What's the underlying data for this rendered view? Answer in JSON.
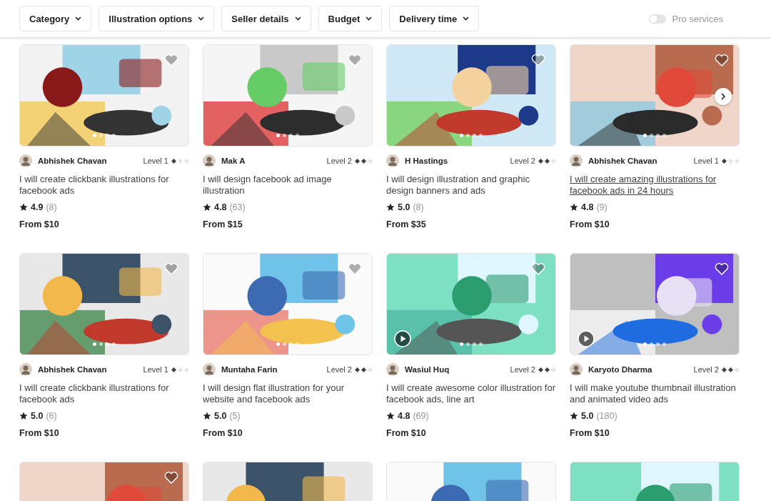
{
  "filters": [
    {
      "label": "Category"
    },
    {
      "label": "Illustration options"
    },
    {
      "label": "Seller details"
    },
    {
      "label": "Budget"
    },
    {
      "label": "Delivery time"
    }
  ],
  "pro_services": {
    "label": "Pro services",
    "on": false
  },
  "cards": [
    {
      "seller": "Abhishek Chavan",
      "level": "Level 1",
      "stars": 1,
      "title": "I will create clickbank illustrations for facebook ads",
      "rating": "4.9",
      "reviews": "(8)",
      "price": "From $10",
      "hovered": false,
      "video": false
    },
    {
      "seller": "Mak A",
      "level": "Level 2",
      "stars": 2,
      "title": "I will design facebook ad image illustration",
      "rating": "4.8",
      "reviews": "(63)",
      "price": "From $15",
      "hovered": false,
      "video": false
    },
    {
      "seller": "H Hastings",
      "level": "Level 2",
      "stars": 2,
      "title": "I will design illustration and graphic design banners and ads",
      "rating": "5.0",
      "reviews": "(8)",
      "price": "From $35",
      "hovered": false,
      "video": false
    },
    {
      "seller": "Abhishek Chavan",
      "level": "Level 1",
      "stars": 1,
      "title": "I will create amazing illustrations for facebook ads in 24 hours",
      "rating": "4.8",
      "reviews": "(9)",
      "price": "From $10",
      "hovered": true,
      "video": false
    },
    {
      "seller": "Abhishek Chavan",
      "level": "Level 1",
      "stars": 1,
      "title": "I will create clickbank illustrations for facebook ads",
      "rating": "5.0",
      "reviews": "(6)",
      "price": "From $10",
      "hovered": false,
      "video": false
    },
    {
      "seller": "Muntaha Farin",
      "level": "Level 2",
      "stars": 2,
      "title": "I will design flat illustration for your website and facebook ads",
      "rating": "5.0",
      "reviews": "(5)",
      "price": "From $10",
      "hovered": false,
      "video": false
    },
    {
      "seller": "Wasiul Huq",
      "level": "Level 2",
      "stars": 2,
      "title": "I will create awesome color illustration for facebook ads, line art",
      "rating": "4.8",
      "reviews": "(69)",
      "price": "From $10",
      "hovered": false,
      "video": true
    },
    {
      "seller": "Karyoto Dharma",
      "level": "Level 2",
      "stars": 2,
      "title": "I will make youtube thumbnail illustration and animated video ads",
      "rating": "5.0",
      "reviews": "(180)",
      "price": "From $10",
      "hovered": false,
      "video": true
    }
  ]
}
